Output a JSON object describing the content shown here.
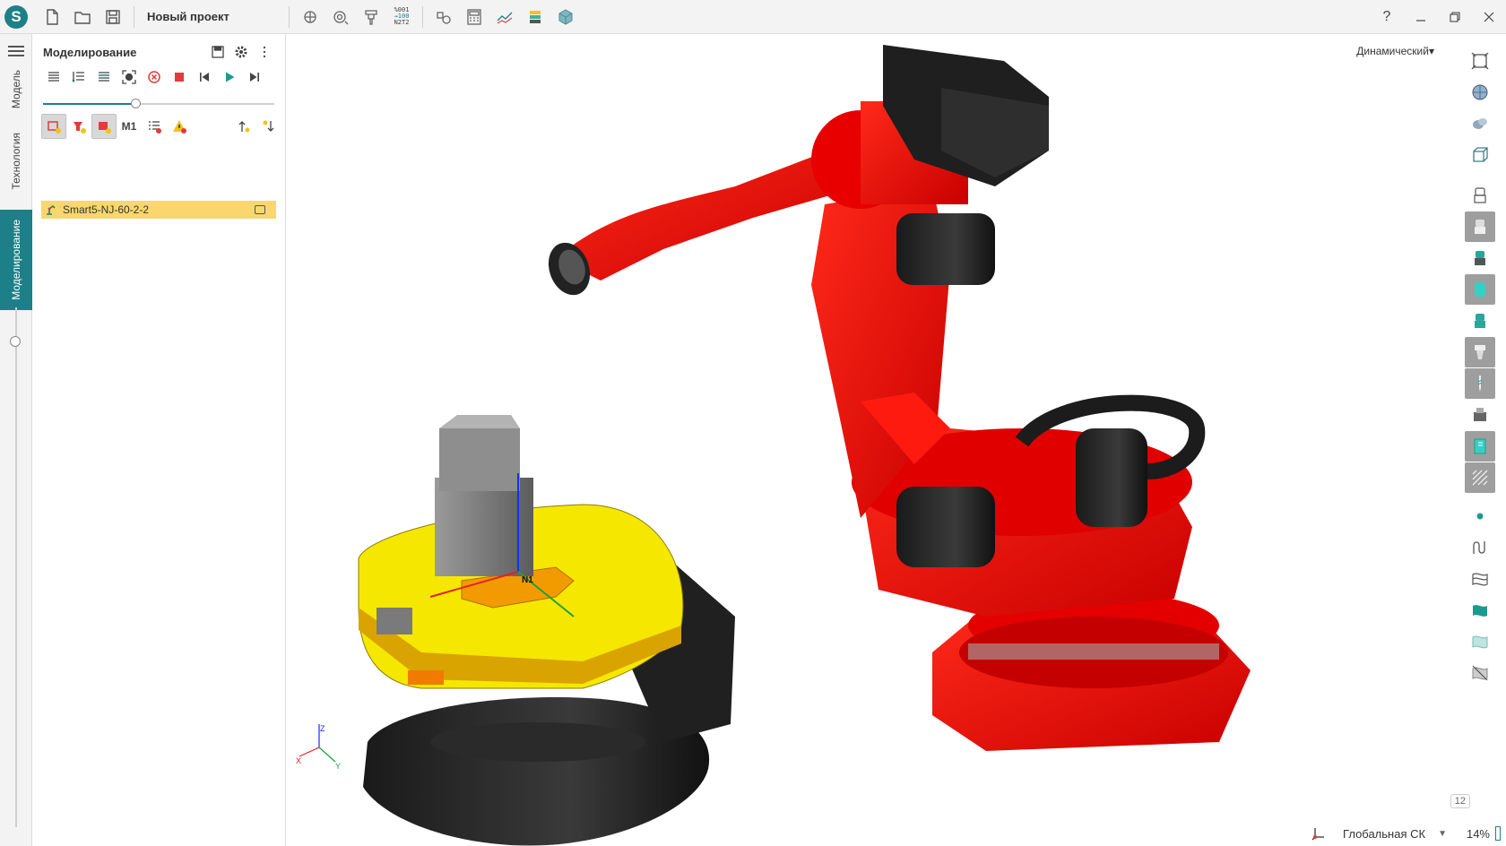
{
  "app": {
    "project_title": "Новый проект",
    "logo_letter": "S",
    "accent_color": "#1d7f87"
  },
  "toolbar": {
    "file_buttons": [
      "new-file-icon",
      "open-folder-icon",
      "save-icon"
    ],
    "tool_buttons": [
      "probe-icon",
      "tool-measure-icon",
      "holder-icon",
      "gcode-icon",
      "machine-icon",
      "calculator-icon",
      "chart-icon",
      "stack-icon",
      "cube-icon"
    ],
    "gcode_label_lines": [
      "%001",
      "→100",
      "N2T2"
    ],
    "help": "?"
  },
  "vtabs": {
    "items": [
      {
        "label": "Модель",
        "active": false
      },
      {
        "label": "Технология",
        "active": false
      },
      {
        "label": "Моделирование",
        "active": true
      }
    ]
  },
  "panel": {
    "title": "Моделирование",
    "tools_row2": [
      "M1"
    ],
    "slider_progress": 0.4,
    "tree": [
      {
        "label": "Smart5-NJ-60-2-2",
        "selected": true
      }
    ]
  },
  "viewport": {
    "view_mode": "Динамический",
    "axes": {
      "x": "X",
      "y": "Y",
      "z": "Z"
    },
    "origin_label": "N1",
    "status": {
      "coord_system": "Глобальная СК",
      "zoom": "14%",
      "counter": "12"
    }
  }
}
